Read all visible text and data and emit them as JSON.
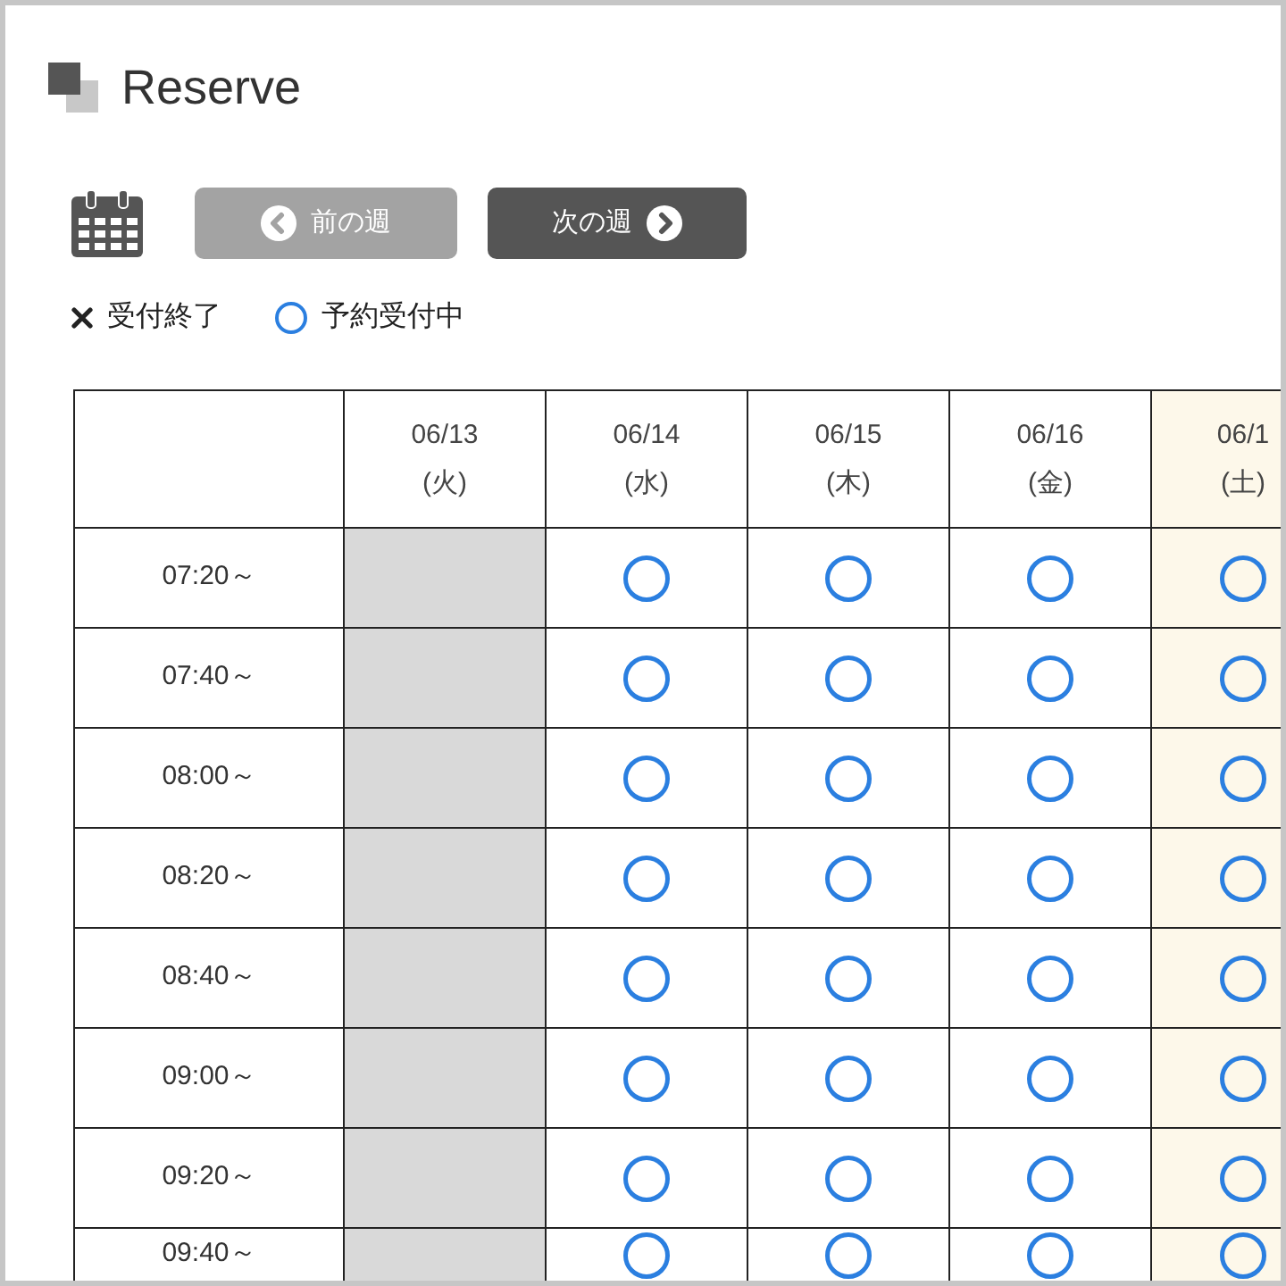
{
  "title": "Reserve",
  "week_nav": [
    {
      "kind": "prev",
      "label": "前の週",
      "disabled": true
    },
    {
      "kind": "next",
      "label": "次の週",
      "disabled": false
    }
  ],
  "legend": [
    {
      "kind": "closed",
      "label": "受付終了"
    },
    {
      "kind": "open",
      "label": "予約受付中"
    }
  ],
  "table": {
    "columns": [
      {
        "date": "06/13",
        "weekday": "(火)",
        "weekend": false
      },
      {
        "date": "06/14",
        "weekday": "(水)",
        "weekend": false
      },
      {
        "date": "06/15",
        "weekday": "(木)",
        "weekend": false
      },
      {
        "date": "06/16",
        "weekday": "(金)",
        "weekend": false
      },
      {
        "date": "06/1",
        "weekday": "(土)",
        "weekend": true
      }
    ],
    "rows": [
      {
        "time": "07:20～",
        "slots": [
          {
            "kind": "unavailable"
          },
          {
            "kind": "open"
          },
          {
            "kind": "open"
          },
          {
            "kind": "open"
          },
          {
            "kind": "open"
          }
        ]
      },
      {
        "time": "07:40～",
        "slots": [
          {
            "kind": "unavailable"
          },
          {
            "kind": "open"
          },
          {
            "kind": "open"
          },
          {
            "kind": "open"
          },
          {
            "kind": "open"
          }
        ]
      },
      {
        "time": "08:00～",
        "slots": [
          {
            "kind": "unavailable"
          },
          {
            "kind": "open"
          },
          {
            "kind": "open"
          },
          {
            "kind": "open"
          },
          {
            "kind": "open"
          }
        ]
      },
      {
        "time": "08:20～",
        "slots": [
          {
            "kind": "unavailable"
          },
          {
            "kind": "open"
          },
          {
            "kind": "open"
          },
          {
            "kind": "open"
          },
          {
            "kind": "open"
          }
        ]
      },
      {
        "time": "08:40～",
        "slots": [
          {
            "kind": "unavailable"
          },
          {
            "kind": "open"
          },
          {
            "kind": "open"
          },
          {
            "kind": "open"
          },
          {
            "kind": "open"
          }
        ]
      },
      {
        "time": "09:00～",
        "slots": [
          {
            "kind": "unavailable"
          },
          {
            "kind": "open"
          },
          {
            "kind": "open"
          },
          {
            "kind": "open"
          },
          {
            "kind": "open"
          }
        ]
      },
      {
        "time": "09:20～",
        "slots": [
          {
            "kind": "unavailable"
          },
          {
            "kind": "open"
          },
          {
            "kind": "open"
          },
          {
            "kind": "open"
          },
          {
            "kind": "open"
          }
        ]
      },
      {
        "time": "09:40～",
        "slots": [
          {
            "kind": "unavailable"
          },
          {
            "kind": "open"
          },
          {
            "kind": "open"
          },
          {
            "kind": "open"
          },
          {
            "kind": "open"
          }
        ]
      }
    ]
  }
}
